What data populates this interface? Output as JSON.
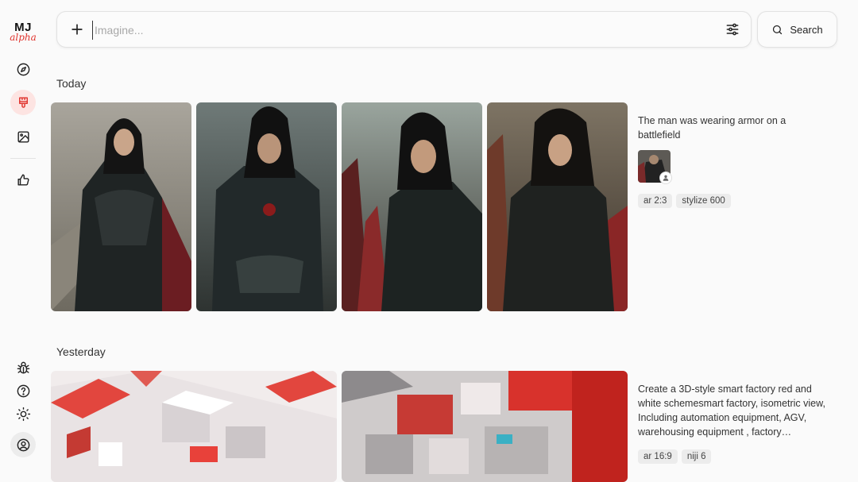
{
  "app": {
    "logo_main": "MJ",
    "logo_sub": "alpha",
    "accent_color": "#e0322c"
  },
  "sidebar": {
    "items": [
      {
        "name": "explore",
        "icon": "compass-icon",
        "active": false
      },
      {
        "name": "create",
        "icon": "brush-icon",
        "active": true
      },
      {
        "name": "organize",
        "icon": "image-icon",
        "active": false
      },
      {
        "name": "rank",
        "icon": "thumbs-up-icon",
        "active": false
      }
    ],
    "bottom_items": [
      {
        "name": "bug",
        "icon": "bug-icon"
      },
      {
        "name": "help",
        "icon": "help-icon"
      },
      {
        "name": "theme",
        "icon": "sun-icon"
      },
      {
        "name": "account",
        "icon": "user-circle-icon"
      }
    ]
  },
  "prompt": {
    "placeholder": "Imagine...",
    "value": ""
  },
  "search": {
    "label": "Search"
  },
  "feed": {
    "today": {
      "title": "Today",
      "prompt_text": "The man was wearing armor on a battlefield",
      "tags": [
        "ar 2:3",
        "stylize 600"
      ]
    },
    "yesterday": {
      "title": "Yesterday",
      "prompt_text": "Create a 3D-style smart factory red and white schemesmart factory, isometric view, Including automation equipment, AGV, warehousing equipment , factory…",
      "tags": [
        "ar 16:9",
        "niji 6"
      ]
    }
  }
}
